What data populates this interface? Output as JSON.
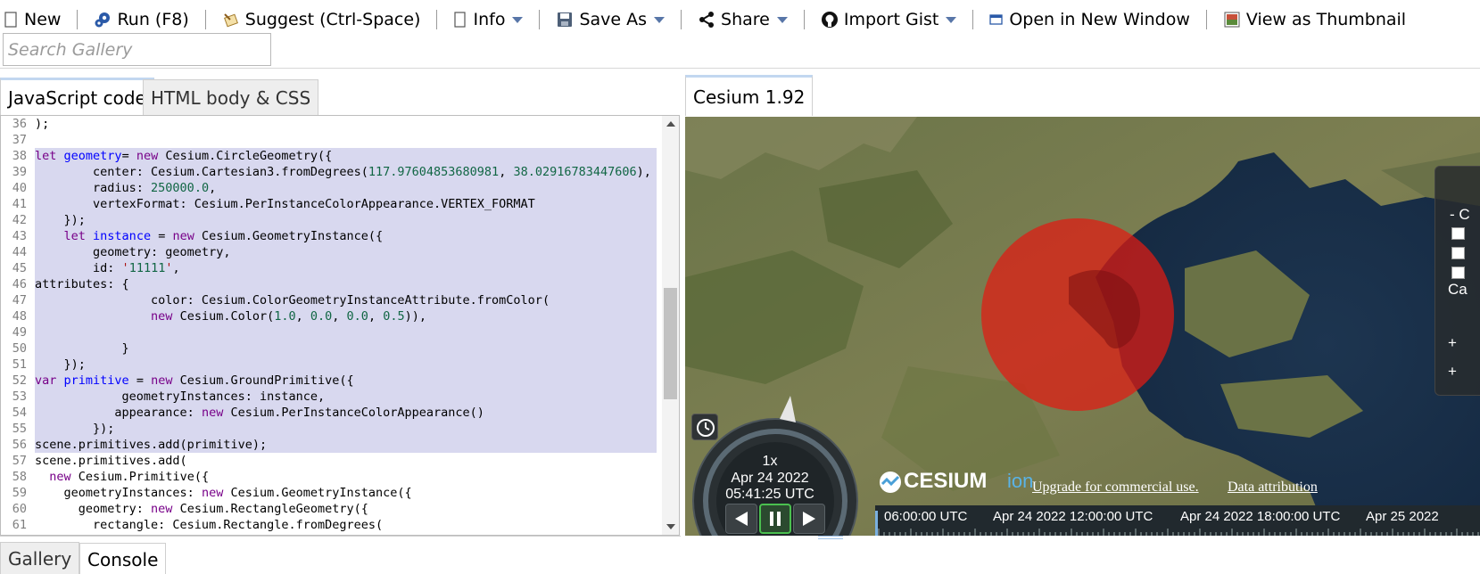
{
  "toolbar": {
    "new_label": "New",
    "run_label": "Run (F8)",
    "suggest_label": "Suggest (Ctrl-Space)",
    "info_label": "Info",
    "save_label": "Save As",
    "share_label": "Share",
    "import_label": "Import Gist",
    "open_window_label": "Open in New Window",
    "thumbnail_label": "View as Thumbnail"
  },
  "search": {
    "placeholder": "Search Gallery",
    "value": ""
  },
  "editor": {
    "tabs": [
      "JavaScript code",
      "HTML body & CSS"
    ],
    "active_tab": "JavaScript code",
    "line_numbers": [
      "36",
      "37",
      "38",
      "39",
      "40",
      "41",
      "42",
      "43",
      "44",
      "45",
      "46",
      "47",
      "48",
      "49",
      "50",
      "51",
      "52",
      "53",
      "54",
      "55",
      "56",
      "57",
      "58",
      "59",
      "60",
      "61"
    ],
    "selected_line_numbers": [
      "38",
      "39",
      "40",
      "41",
      "42",
      "43",
      "44",
      "45",
      "46",
      "47",
      "48",
      "49",
      "50",
      "51",
      "52",
      "53",
      "54",
      "55",
      "56"
    ],
    "lines": [
      ");",
      "",
      "let geometry= new Cesium.CircleGeometry({",
      "        center: Cesium.Cartesian3.fromDegrees(117.97604853680981, 38.02916783447606),",
      "        radius: 250000.0,",
      "        vertexFormat: Cesium.PerInstanceColorAppearance.VERTEX_FORMAT",
      "    });",
      "    let instance = new Cesium.GeometryInstance({",
      "        geometry: geometry,",
      "        id: '11111',",
      "attributes: {",
      "                color: Cesium.ColorGeometryInstanceAttribute.fromColor(",
      "                new Cesium.Color(1.0, 0.0, 0.0, 0.5)),",
      "",
      "            }",
      "    });",
      "var primitive = new Cesium.GroundPrimitive({",
      "            geometryInstances: instance,",
      "           appearance: new Cesium.PerInstanceColorAppearance()",
      "        });",
      "scene.primitives.add(primitive);",
      "scene.primitives.add(",
      "  new Cesium.Primitive({",
      "    geometryInstances: new Cesium.GeometryInstance({",
      "      geometry: new Cesium.RectangleGeometry({",
      "        rectangle: Cesium.Rectangle.fromDegrees("
    ]
  },
  "bottom_tabs": [
    "Gallery",
    "Console"
  ],
  "bottom_active_tab": "Console",
  "viewer": {
    "tab_label": "Cesium 1.92",
    "animation": {
      "speed": "1x",
      "date": "Apr 24 2022",
      "time": "05:41:25 UTC"
    },
    "credits": {
      "logo_text": "CESIUM",
      "logo_suffix": "ion",
      "upgrade_link": "Upgrade for commercial use.",
      "attribution_link": "Data attribution"
    },
    "timeline_labels": [
      "06:00:00 UTC",
      "Apr 24 2022 12:00:00 UTC",
      "Apr 24 2022 18:00:00 UTC",
      "Apr 25 2022"
    ],
    "layers_panel": {
      "header_glyph": "- C",
      "partial_label": "Ca",
      "plus_glyphs": [
        "+",
        "+"
      ]
    },
    "circle_color": "#e21b12"
  }
}
